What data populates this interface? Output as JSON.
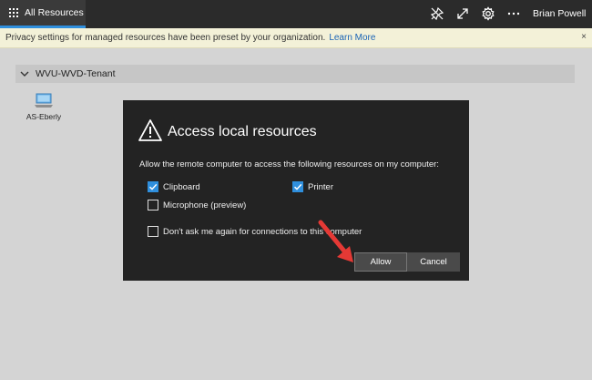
{
  "topbar": {
    "tab_label": "All Resources",
    "icons": [
      "pin-icon",
      "expand-icon",
      "gear-icon",
      "more-icon"
    ],
    "user": "Brian Powell"
  },
  "banner": {
    "text": "Privacy settings for managed resources have been preset by your organization.",
    "link": "Learn More",
    "close": "×"
  },
  "group": {
    "name": "WVU-WVD-Tenant"
  },
  "resource": {
    "label": "AS-Eberly"
  },
  "dialog": {
    "title": "Access local resources",
    "description": "Allow the remote computer to access the following resources on my computer:",
    "options": [
      {
        "label": "Clipboard",
        "checked": true
      },
      {
        "label": "Printer",
        "checked": true
      },
      {
        "label": "Microphone (preview)",
        "checked": false
      }
    ],
    "dont_ask": {
      "label": "Don't ask me again for connections to this computer",
      "checked": false
    },
    "allow_label": "Allow",
    "cancel_label": "Cancel"
  },
  "colors": {
    "accent": "#2f8fdd",
    "dialog_bg": "#232323",
    "annotation_arrow": "#e53935"
  }
}
